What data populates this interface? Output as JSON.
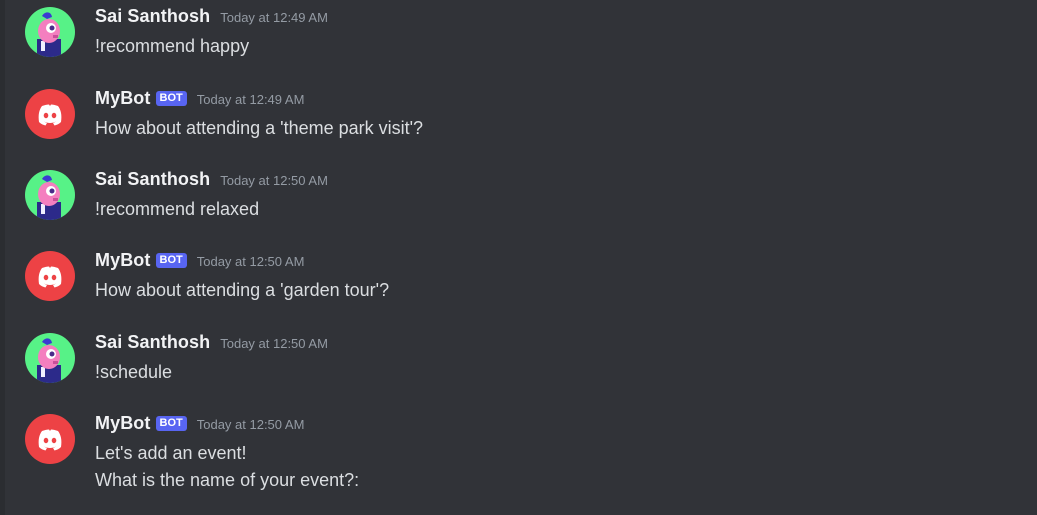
{
  "colors": {
    "background": "#313338",
    "bot_tag": "#5865f2",
    "bot_avatar": "#ed4245",
    "user_avatar": "#57f287"
  },
  "messages": [
    {
      "author": "Sai Santhosh",
      "is_bot": false,
      "avatar_icon": "user-avatar-icon",
      "timestamp": "Today at 12:49 AM",
      "lines": [
        "!recommend happy"
      ]
    },
    {
      "author": "MyBot",
      "is_bot": true,
      "bot_tag": "BOT",
      "avatar_icon": "discord-logo-icon",
      "timestamp": "Today at 12:49 AM",
      "lines": [
        "How about attending a 'theme park visit'?"
      ]
    },
    {
      "author": "Sai Santhosh",
      "is_bot": false,
      "avatar_icon": "user-avatar-icon",
      "timestamp": "Today at 12:50 AM",
      "lines": [
        "!recommend relaxed"
      ]
    },
    {
      "author": "MyBot",
      "is_bot": true,
      "bot_tag": "BOT",
      "avatar_icon": "discord-logo-icon",
      "timestamp": "Today at 12:50 AM",
      "lines": [
        "How about attending a 'garden tour'?"
      ]
    },
    {
      "author": "Sai Santhosh",
      "is_bot": false,
      "avatar_icon": "user-avatar-icon",
      "timestamp": "Today at 12:50 AM",
      "lines": [
        "!schedule"
      ]
    },
    {
      "author": "MyBot",
      "is_bot": true,
      "bot_tag": "BOT",
      "avatar_icon": "discord-logo-icon",
      "timestamp": "Today at 12:50 AM",
      "lines": [
        "Let's add an event!",
        "What is the name of your event?:"
      ]
    }
  ]
}
